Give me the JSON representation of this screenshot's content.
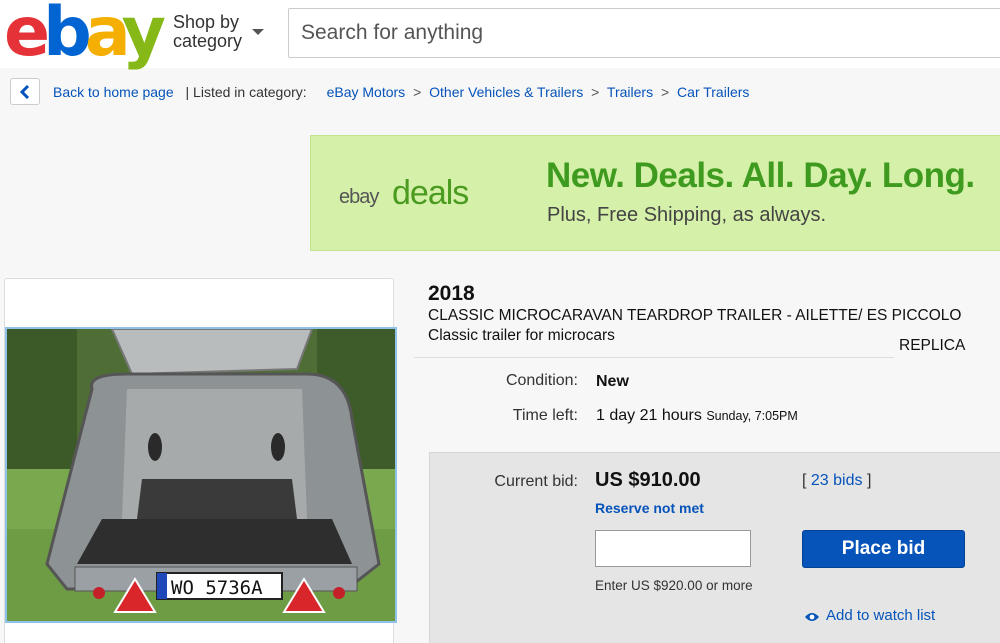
{
  "header": {
    "logo": {
      "e": "e",
      "b": "b",
      "a": "a",
      "y": "y"
    },
    "shop_by_line1": "Shop by",
    "shop_by_line2": "category",
    "search_placeholder": "Search for anything"
  },
  "breadcrumb": {
    "back": "Back to home page",
    "listed_in": "| Listed in category:",
    "items": [
      "eBay Motors",
      "Other Vehicles & Trailers",
      "Trailers",
      "Car Trailers"
    ],
    "separator": ">"
  },
  "banner": {
    "ebay": "ebay",
    "deals": "deals",
    "headline": "New. Deals. All. Day. Long.",
    "subline": "Plus, Free Shipping, as always."
  },
  "listing": {
    "year": "2018",
    "title": "CLASSIC MICROCARAVAN TEARDROP TRAILER - AILETTE/ ES PICCOLO",
    "subtitle": "Classic trailer for microcars",
    "replica": "REPLICA",
    "condition_label": "Condition:",
    "condition_value": "New",
    "time_left_label": "Time left:",
    "time_left_value": "1 day 21 hours",
    "time_left_detail": "Sunday, 7:05PM",
    "plate": "WO 5736A"
  },
  "bid": {
    "current_bid_label": "Current bid:",
    "price": "US $910.00",
    "reserve": "Reserve not met",
    "bids_count": "23 bids",
    "bids_open": "[",
    "bids_close": "]",
    "input_value": "",
    "hint": "Enter US $920.00 or more",
    "place_bid": "Place bid",
    "watch": "Add to watch list"
  },
  "colors": {
    "link": "#0654ba",
    "banner_bg": "#d5f0a8",
    "banner_green": "#3f9b1f",
    "button": "#0654ba"
  }
}
